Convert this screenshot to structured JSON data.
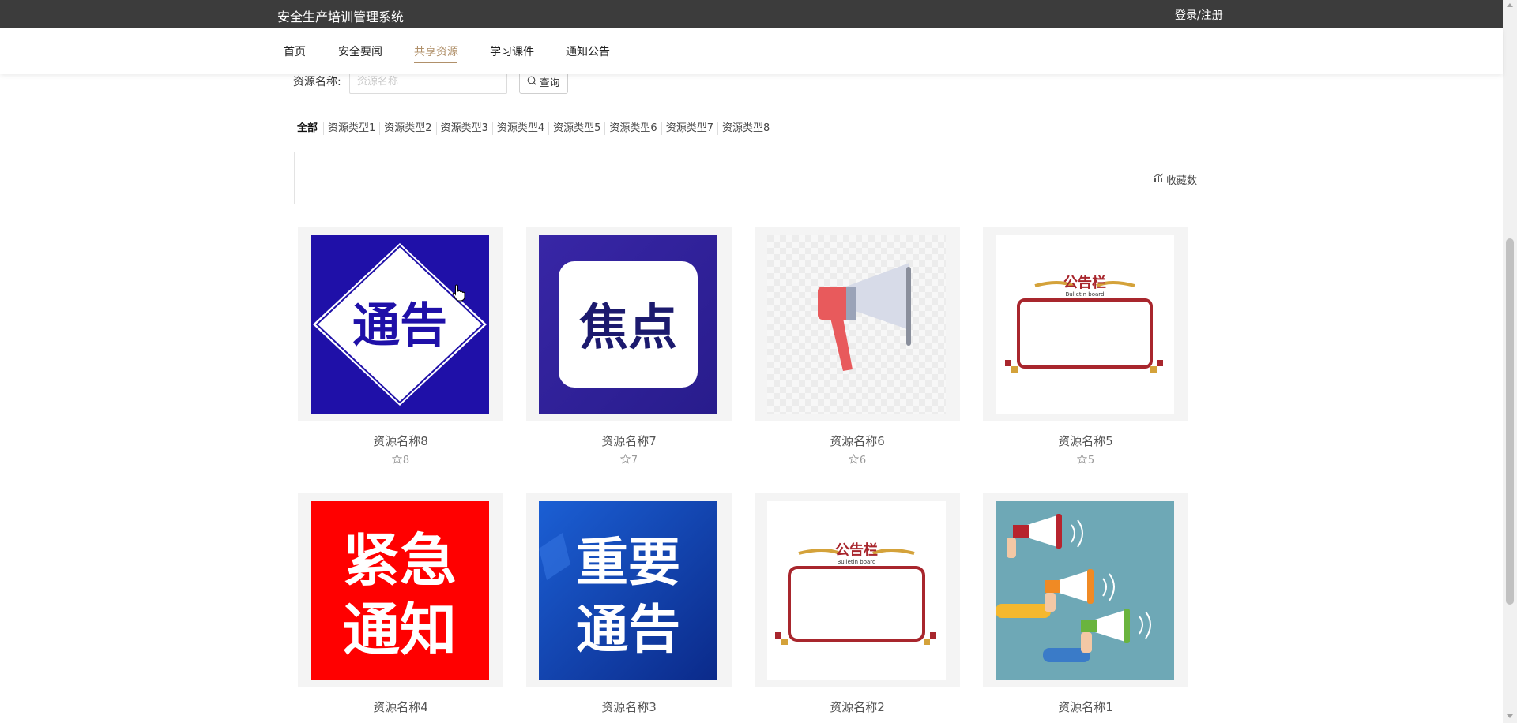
{
  "header": {
    "site_title": "安全生产培训管理系统",
    "login_label": "登录/注册"
  },
  "nav": {
    "items": [
      {
        "label": "首页"
      },
      {
        "label": "安全要闻"
      },
      {
        "label": "共享资源",
        "active": true
      },
      {
        "label": "学习课件"
      },
      {
        "label": "通知公告"
      }
    ]
  },
  "search": {
    "label": "资源名称:",
    "placeholder": "资源名称",
    "button_label": "查询"
  },
  "categories": [
    "全部",
    "资源类型1",
    "资源类型2",
    "资源类型3",
    "资源类型4",
    "资源类型5",
    "资源类型6",
    "资源类型7",
    "资源类型8"
  ],
  "sort": {
    "label": "收藏数"
  },
  "resources": [
    {
      "name": "资源名称8",
      "favorites": "8",
      "image": "notice-sign-blue"
    },
    {
      "name": "资源名称7",
      "favorites": "7",
      "image": "focus-sign-purple"
    },
    {
      "name": "资源名称6",
      "favorites": "6",
      "image": "megaphone"
    },
    {
      "name": "资源名称5",
      "favorites": "5",
      "image": "bulletin-board"
    },
    {
      "name": "资源名称4",
      "favorites": "",
      "image": "urgent-notice-red"
    },
    {
      "name": "资源名称3",
      "favorites": "",
      "image": "important-notice-blue"
    },
    {
      "name": "资源名称2",
      "favorites": "",
      "image": "bulletin-board"
    },
    {
      "name": "资源名称1",
      "favorites": "",
      "image": "hands-megaphones"
    }
  ],
  "image_text": {
    "notice": "通告",
    "focus": "焦点",
    "urgent_1": "紧急",
    "urgent_2": "通知",
    "important_1": "重要",
    "important_2": "通告",
    "bulletin_title": "公告栏",
    "bulletin_sub": "Bulletin board"
  },
  "colors": {
    "topbar": "#3c3c3c",
    "accent": "#b0906a",
    "notice_blue": "#1f10a8",
    "urgent_red": "#ff0000",
    "board_red": "#a8262d"
  }
}
